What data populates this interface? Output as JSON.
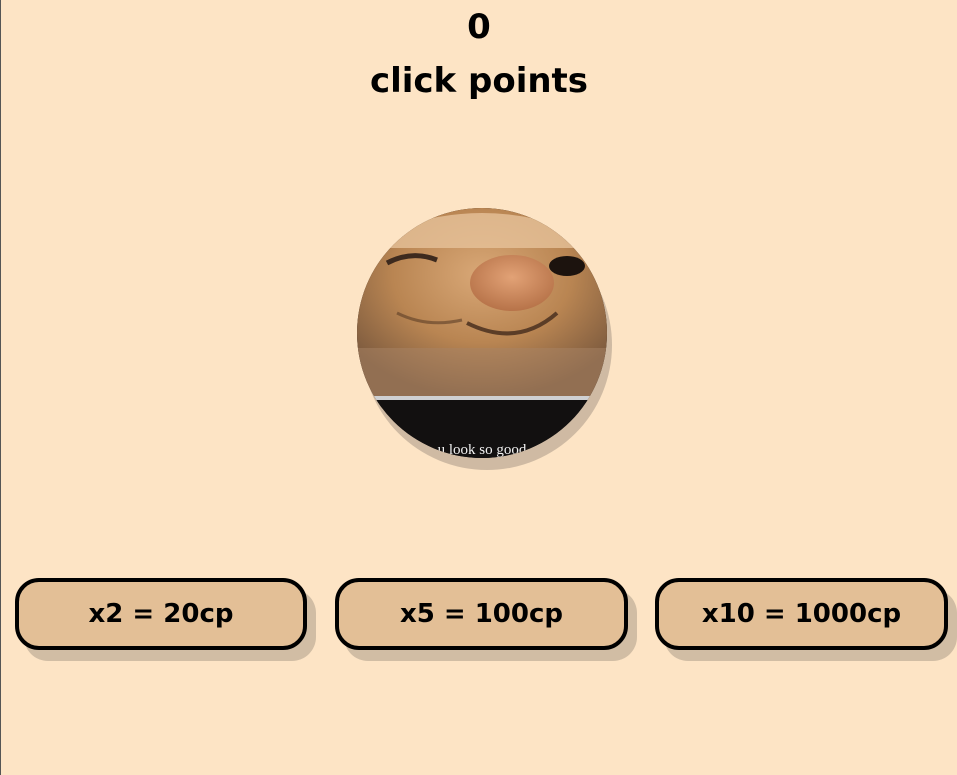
{
  "score": {
    "value": "0",
    "unit_label": "click points"
  },
  "clicker": {
    "image_name": "cat-face-image",
    "caption": "u look so good"
  },
  "upgrades": [
    {
      "label": "x2 = 20cp"
    },
    {
      "label": "x5 = 100cp"
    },
    {
      "label": "x10 = 1000cp"
    }
  ],
  "colors": {
    "background": "#fde4c5",
    "button": "#e3bf96",
    "border": "#000000"
  }
}
